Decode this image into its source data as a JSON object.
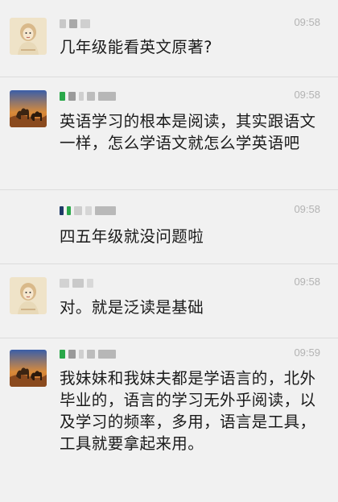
{
  "messages": [
    {
      "time": "09:58",
      "text": "几年级能看英文原著?"
    },
    {
      "time": "09:58",
      "text": "英语学习的根本是阅读，其实跟语文一样，怎么学语文就怎么学英语吧"
    },
    {
      "time": "09:58",
      "text": "四五年级就没问题啦"
    },
    {
      "time": "09:58",
      "text": "对。就是泛读是基础"
    },
    {
      "time": "09:59",
      "text": "我妹妹和我妹夫都是学语言的，北外毕业的，语言的学习无外乎阅读，以及学习的频率，多用，语言是工具，工具就要拿起来用。"
    }
  ],
  "colors": {
    "background": "#f1f1f1",
    "time": "#b3b3b3",
    "text": "#1a1a1a",
    "divider": "#dcdcdc",
    "badge_green": "#2aa84a"
  },
  "icons": [
    "cartoon-girl-avatar",
    "camel-desert-avatar"
  ]
}
